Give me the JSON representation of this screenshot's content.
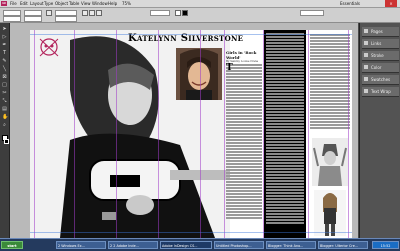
{
  "menubar": {
    "logo": "Id",
    "menus": [
      "File",
      "Edit",
      "Layout",
      "Type",
      "Object",
      "Table",
      "View",
      "Window",
      "Help"
    ],
    "zoom": "75%",
    "workspace": "Essentials"
  },
  "panel": {
    "items": [
      {
        "label": "Pages",
        "icon": "pages-icon"
      },
      {
        "label": "Links",
        "icon": "links-icon"
      },
      {
        "label": "Stroke",
        "icon": "stroke-icon"
      },
      {
        "label": "Color",
        "icon": "color-icon"
      },
      {
        "label": "Swatches",
        "icon": "swatches-icon"
      },
      {
        "label": "Text Wrap",
        "icon": "text-wrap-icon"
      }
    ]
  },
  "document": {
    "headline": "Katelynn Silverstone",
    "subhead": "Girls in 'Rock World'",
    "byline": "By Sammy Louise Crane"
  },
  "taskbar": {
    "start": "start",
    "buttons": [
      "2 Windows Ex...",
      "2 2 Adobe Inde...",
      "Adobe InDesign CS...",
      "Untitled Photoshop...",
      "Blogger: Think Ano...",
      "Blogger: Ulterior Cre..."
    ],
    "clock": "15:52"
  },
  "colors": {
    "accent": "#b3245c",
    "taskbar": "#243a5e",
    "panel": "#535353"
  }
}
